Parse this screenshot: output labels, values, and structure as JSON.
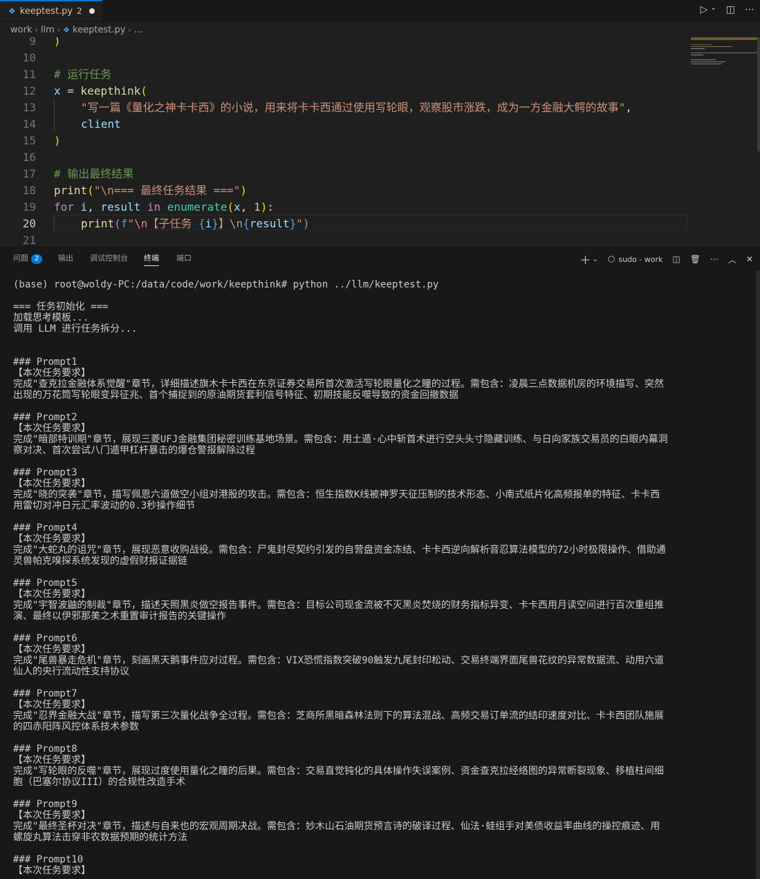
{
  "tab": {
    "filename": "keeptest.py",
    "problem_count": "2"
  },
  "breadcrumb": {
    "items": [
      "work",
      "llm",
      "keeptest.py",
      "..."
    ]
  },
  "code_lines": [
    {
      "n": "9"
    },
    {
      "n": "10"
    },
    {
      "n": "11"
    },
    {
      "n": "12"
    },
    {
      "n": "13"
    },
    {
      "n": "14"
    },
    {
      "n": "15"
    },
    {
      "n": "16"
    },
    {
      "n": "17"
    },
    {
      "n": "18"
    },
    {
      "n": "19"
    },
    {
      "n": "20"
    },
    {
      "n": "21"
    }
  ],
  "code": {
    "l9": ")",
    "l11": "# 运行任务",
    "l12_var": "x",
    "l12_fn": "keepthink",
    "l13_str": "\"写一篇《量化之神卡卡西》的小说，用来将卡卡西通过使用写轮眼，观察股市涨跌，成为一方金融大鳄的故事\"",
    "l14": "client",
    "l15": ")",
    "l17": "# 输出最终结果",
    "l18_fn": "print",
    "l18_str": "\"\\n=== 最终任务结果 ===\"",
    "l19_kw1": "for",
    "l19_i": "i",
    "l19_result": "result",
    "l19_kw2": "in",
    "l19_fn": "enumerate",
    "l19_x": "x",
    "l19_num": "1",
    "l20_fn": "print",
    "l20_f": "f",
    "l20_s1": "\"\\n【子任务 ",
    "l20_i": "i",
    "l20_s2": "】\\n",
    "l20_result": "result",
    "l20_s3": "\""
  },
  "panel": {
    "tabs": [
      "问题",
      "输出",
      "调试控制台",
      "终端",
      "端口"
    ],
    "problems_badge": "2",
    "terminal_name": "sudo - work"
  },
  "terminal": {
    "lines": [
      "(base) root@woldy-PC:/data/code/work/keepthink# python ../llm/keeptest.py",
      "",
      "=== 任务初始化 ===",
      "加载思考模板...",
      "调用 LLM 进行任务拆分...",
      "",
      "",
      "### Prompt1",
      "【本次任务要求】",
      "完成\"查克拉金融体系觉醒\"章节，详细描述旗木卡卡西在东京证券交易所首次激活写轮眼量化之瞳的过程。需包含：凌晨三点数据机房的环境描写、突然",
      "出现的万花筒写轮眼变异征兆、首个捕捉到的原油期货套利信号特征、初期技能反噬导致的资金回撤数据",
      "",
      "### Prompt2",
      "【本次任务要求】",
      "完成\"暗部特训期\"章节，展现三菱UFJ金融集团秘密训练基地场景。需包含：用土遁·心中斩首术进行空头头寸隐藏训练、与日向家族交易员的白眼内幕洞",
      "察对决、首次尝试八门遁甲杠杆暴击的爆仓警报解除过程",
      "",
      "### Prompt3",
      "【本次任务要求】",
      "完成\"晓的突袭\"章节，描写佩恩六道做空小组对港股的攻击。需包含：恒生指数K线被神罗天征压制的技术形态、小南式纸片化高频报单的特征、卡卡西",
      "用雷切对冲日元汇率波动的0.3秒操作细节",
      "",
      "### Prompt4",
      "【本次任务要求】",
      "完成\"大蛇丸的诅咒\"章节，展现恶意收购战役。需包含：尸鬼封尽契约引发的自营盘资金冻结、卡卡西逆向解析音忍算法模型的72小时极限操作、借助通",
      "灵兽帕克嗅探系统发现的虚假财报证据链",
      "",
      "### Prompt5",
      "【本次任务要求】",
      "完成\"宇智波鼬的制裁\"章节，描述天照黑炎做空报告事件。需包含：目标公司现金流被不灭黑炎焚烧的财务指标异变、卡卡西用月读空间进行百次重组推",
      "演、最终以伊邪那美之术重置审计报告的关键操作",
      "",
      "### Prompt6",
      "【本次任务要求】",
      "完成\"尾兽暴走危机\"章节，刻画黑天鹅事件应对过程。需包含：VIX恐慌指数突破90触发九尾封印松动、交易终端界面尾兽花纹的异常数据流、动用六道",
      "仙人的央行流动性支持协议",
      "",
      "### Prompt7",
      "【本次任务要求】",
      "完成\"忍界金融大战\"章节，描写第三次量化战争全过程。需包含：芝商所黑暗森林法则下的算法混战、高频交易订单流的结印速度对比、卡卡西团队施展",
      "的四赤阳阵风控体系技术参数",
      "",
      "### Prompt8",
      "【本次任务要求】",
      "完成\"写轮眼的反噬\"章节，展现过度使用量化之瞳的后果。需包含：交易直觉钝化的具体操作失误案例、资金查克拉经络图的异常断裂现象、移植柱间细",
      "胞（巴塞尔协议III）的合规性改造手术",
      "",
      "### Prompt9",
      "【本次任务要求】",
      "完成\"最终圣杯对决\"章节，描述与自来也的宏观周期决战。需包含：妙木山石油期货预言诗的破译过程、仙法·蛙组手对美债收益率曲线的操控痕迹、用",
      "螺旋丸算法击穿非农数据预期的统计方法",
      "",
      "### Prompt10",
      "【本次任务要求】"
    ]
  }
}
